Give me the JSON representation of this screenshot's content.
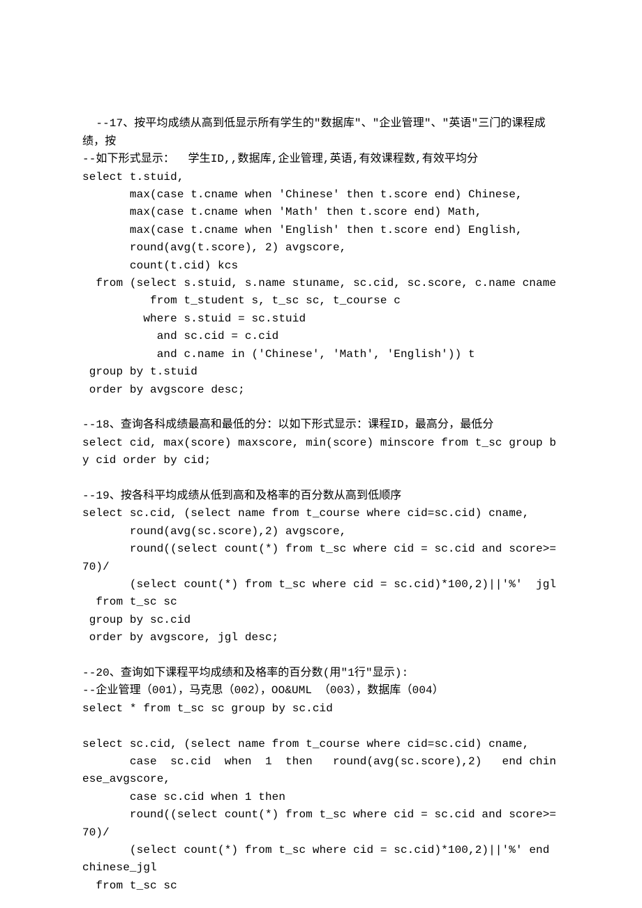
{
  "doc": {
    "content": "--17、按平均成绩从高到低显示所有学生的\"数据库\"、\"企业管理\"、\"英语\"三门的课程成绩，按\n--如下形式显示：  学生ID,,数据库,企业管理,英语,有效课程数,有效平均分\nselect t.stuid,\n       max(case t.cname when 'Chinese' then t.score end) Chinese,\n       max(case t.cname when 'Math' then t.score end) Math,\n       max(case t.cname when 'English' then t.score end) English,\n       round(avg(t.score), 2) avgscore,\n       count(t.cid) kcs\n  from (select s.stuid, s.name stuname, sc.cid, sc.score, c.name cname\n          from t_student s, t_sc sc, t_course c\n         where s.stuid = sc.stuid\n           and sc.cid = c.cid\n           and c.name in ('Chinese', 'Math', 'English')) t\n group by t.stuid\n order by avgscore desc;\n\n--18、查询各科成绩最高和最低的分：以如下形式显示：课程ID，最高分，最低分\nselect cid, max(score) maxscore, min(score) minscore from t_sc group by cid order by cid;\n\n--19、按各科平均成绩从低到高和及格率的百分数从高到低顺序\nselect sc.cid, (select name from t_course where cid=sc.cid) cname,\n       round(avg(sc.score),2) avgscore,\n       round((select count(*) from t_sc where cid = sc.cid and score>=70)/\n       (select count(*) from t_sc where cid = sc.cid)*100,2)||'%'  jgl\n  from t_sc sc\n group by sc.cid\n order by avgscore, jgl desc;\n\n--20、查询如下课程平均成绩和及格率的百分数(用\"1行\"显示):\n--企业管理（001），马克思（002），OO&UML （003），数据库（004）\nselect * from t_sc sc group by sc.cid\n\nselect sc.cid, (select name from t_course where cid=sc.cid) cname,\n       case  sc.cid  when  1  then   round(avg(sc.score),2)   end chinese_avgscore,\n       case sc.cid when 1 then\n       round((select count(*) from t_sc where cid = sc.cid and score>=70)/\n       (select count(*) from t_sc where cid = sc.cid)*100,2)||'%' end chinese_jgl\n  from t_sc sc"
  }
}
